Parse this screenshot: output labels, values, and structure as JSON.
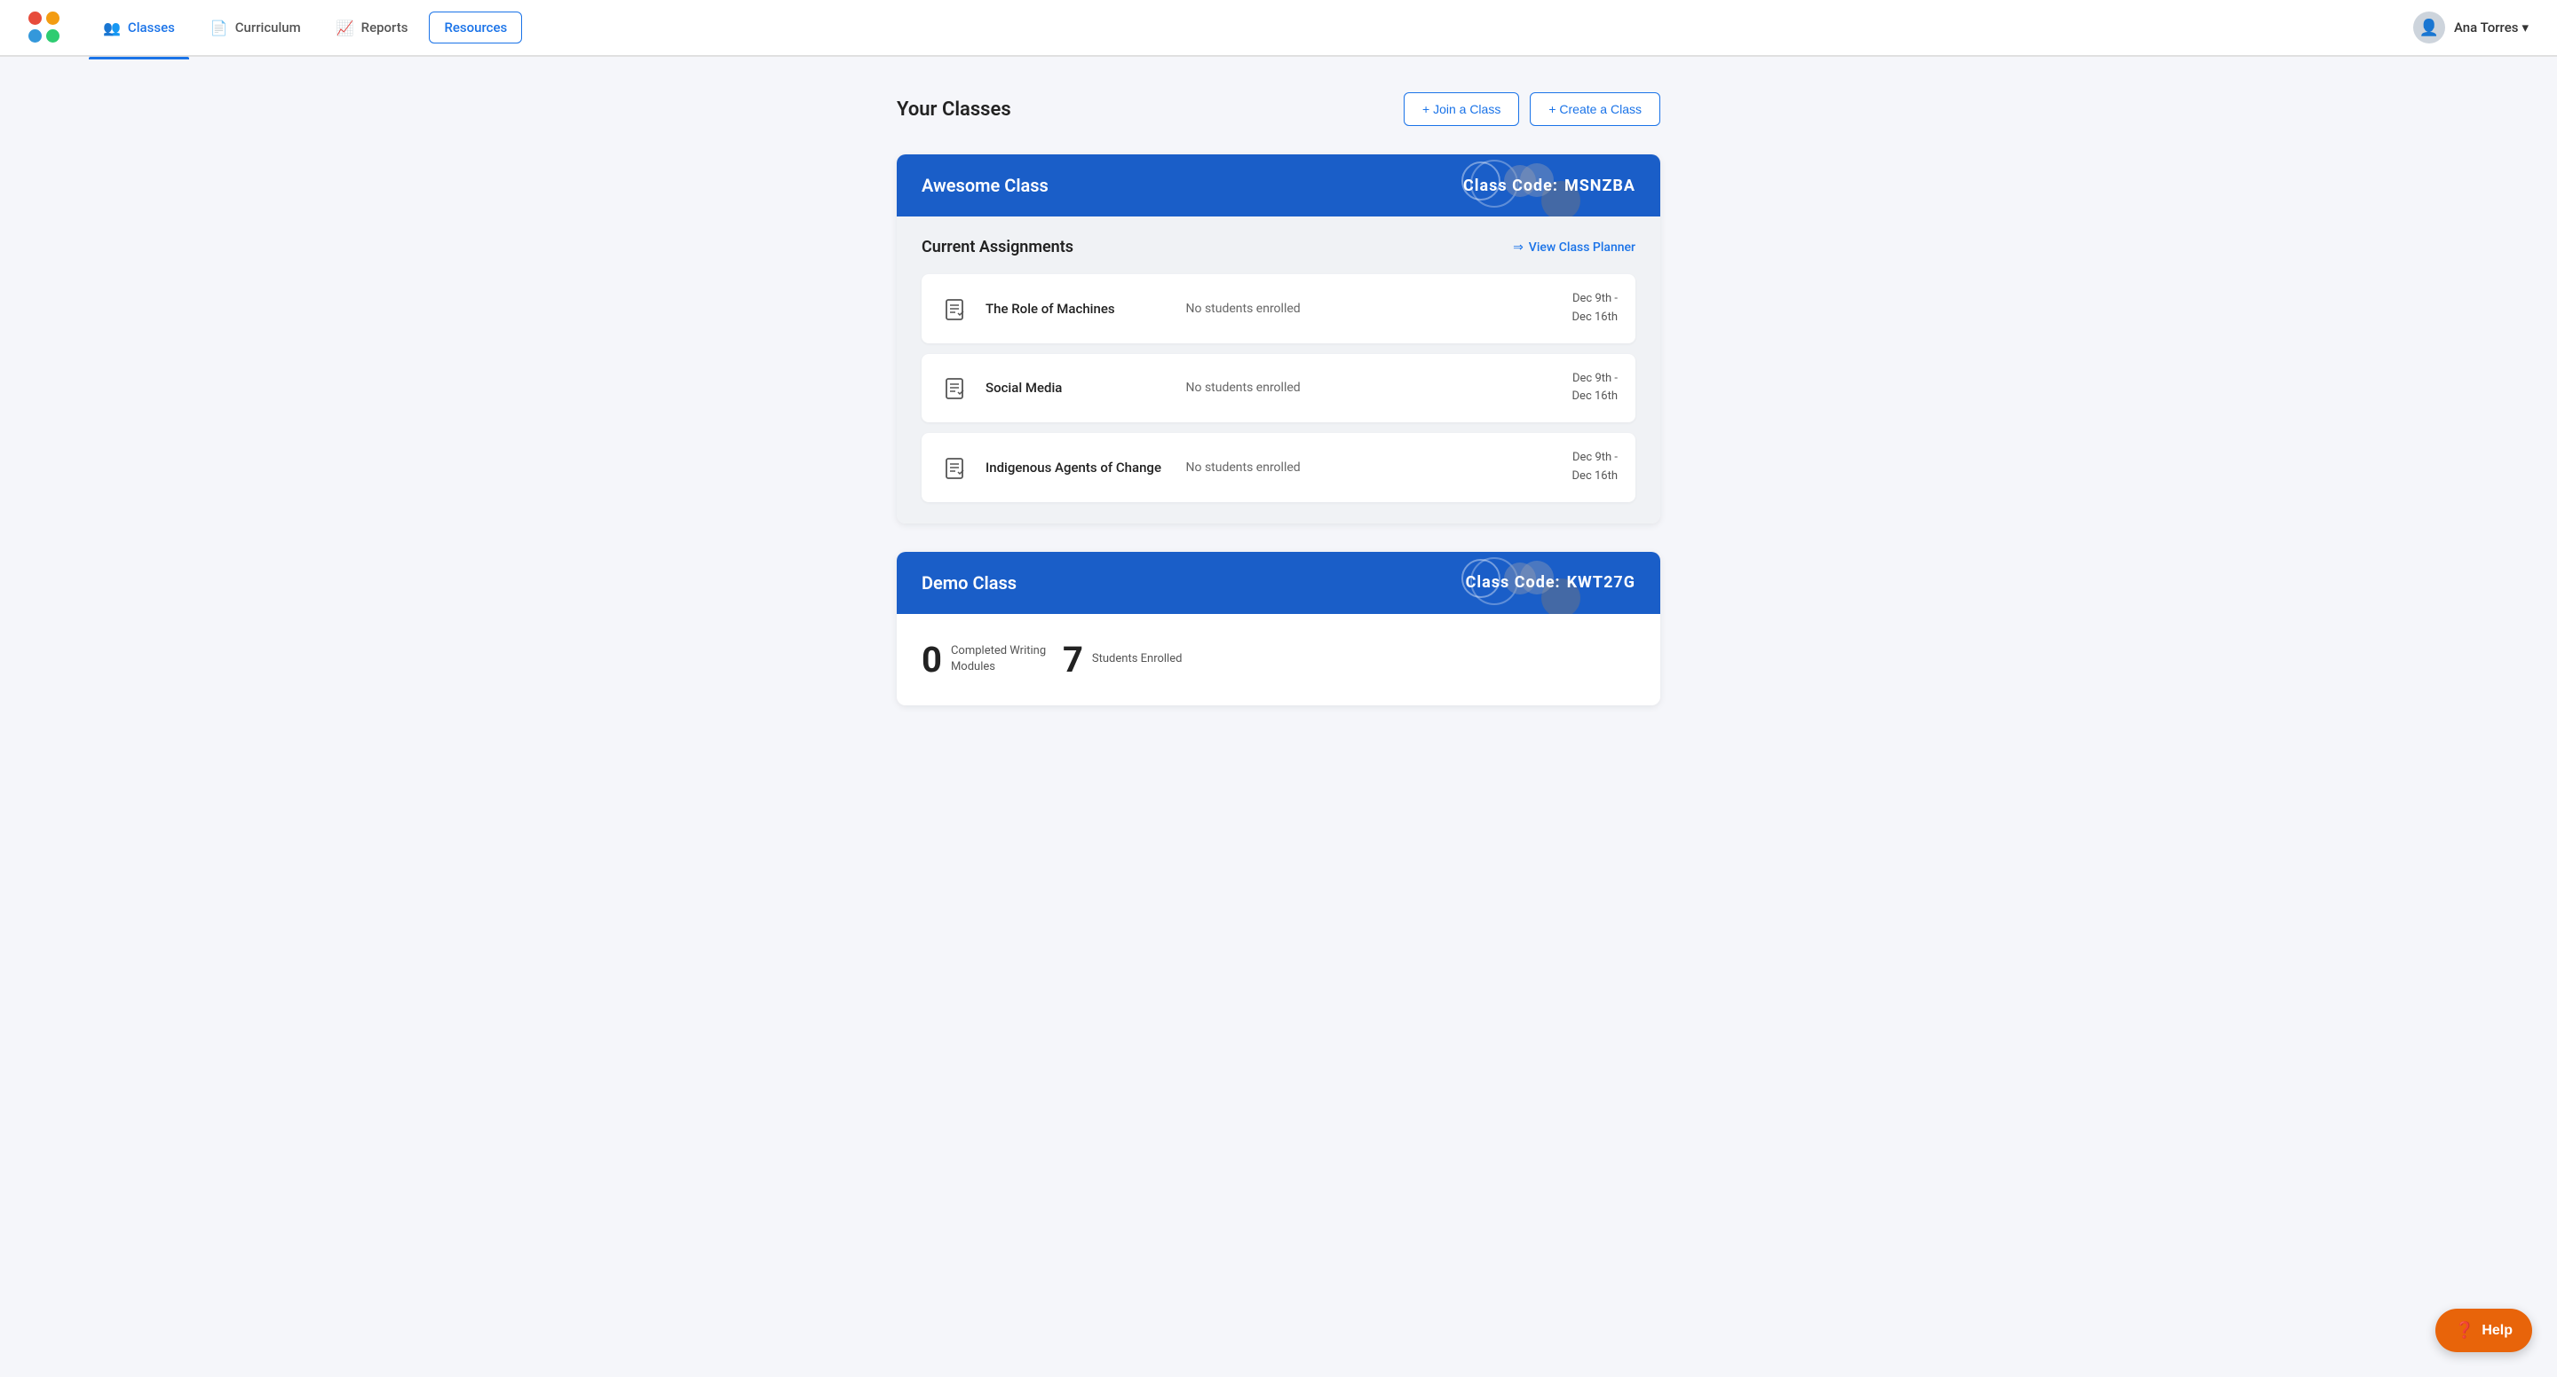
{
  "nav": {
    "items": [
      {
        "id": "classes",
        "label": "Classes",
        "active": true,
        "icon": "👥"
      },
      {
        "id": "curriculum",
        "label": "Curriculum",
        "active": false,
        "icon": "📄"
      },
      {
        "id": "reports",
        "label": "Reports",
        "active": false,
        "icon": "📈"
      },
      {
        "id": "resources",
        "label": "Resources",
        "active": false,
        "icon": ""
      }
    ],
    "user": "Ana Torres"
  },
  "page": {
    "title": "Your Classes",
    "join_button": "+ Join a Class",
    "create_button": "+ Create a Class"
  },
  "classes": [
    {
      "id": "awesome",
      "name": "Awesome Class",
      "code": "MSNZBA",
      "code_label": "Class Code:",
      "assignments_title": "Current Assignments",
      "view_planner": "View Class Planner",
      "assignments": [
        {
          "name": "The Role of Machines",
          "status": "No students enrolled",
          "date_start": "Dec 9th -",
          "date_end": "Dec 16th"
        },
        {
          "name": "Social Media",
          "status": "No students enrolled",
          "date_start": "Dec 9th -",
          "date_end": "Dec 16th"
        },
        {
          "name": "Indigenous Agents of Change",
          "status": "No students enrolled",
          "date_start": "Dec 9th -",
          "date_end": "Dec 16th"
        }
      ]
    },
    {
      "id": "demo",
      "name": "Demo Class",
      "code": "KWT27G",
      "code_label": "Class Code:",
      "assignments_title": "",
      "view_planner": "",
      "assignments": [],
      "stats": {
        "completed": "0",
        "completed_label": "Completed Writing Modules",
        "enrolled": "7",
        "enrolled_label": "Students Enrolled"
      }
    }
  ],
  "help_button": "Help"
}
